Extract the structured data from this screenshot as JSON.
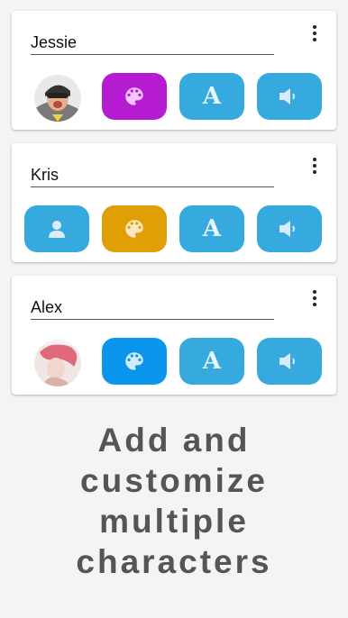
{
  "characters": [
    {
      "name": "Jessie",
      "avatar": "photo-avatar",
      "palette_color": "#b51bd1"
    },
    {
      "name": "Kris",
      "avatar": "person-icon",
      "palette_color": "#e19f06"
    },
    {
      "name": "Alex",
      "avatar": "photo-avatar",
      "palette_color": "#0b96ee"
    }
  ],
  "buttons": {
    "font_glyph": "A",
    "button_color": "#36a9df"
  },
  "icons": {
    "menu": "more-vertical-icon",
    "palette": "palette-icon",
    "font": "font-icon",
    "voice": "speaker-icon",
    "person": "person-icon"
  },
  "footer": {
    "line1": "Add and",
    "line2": "customize",
    "line3": "multiple",
    "line4": "characters"
  }
}
